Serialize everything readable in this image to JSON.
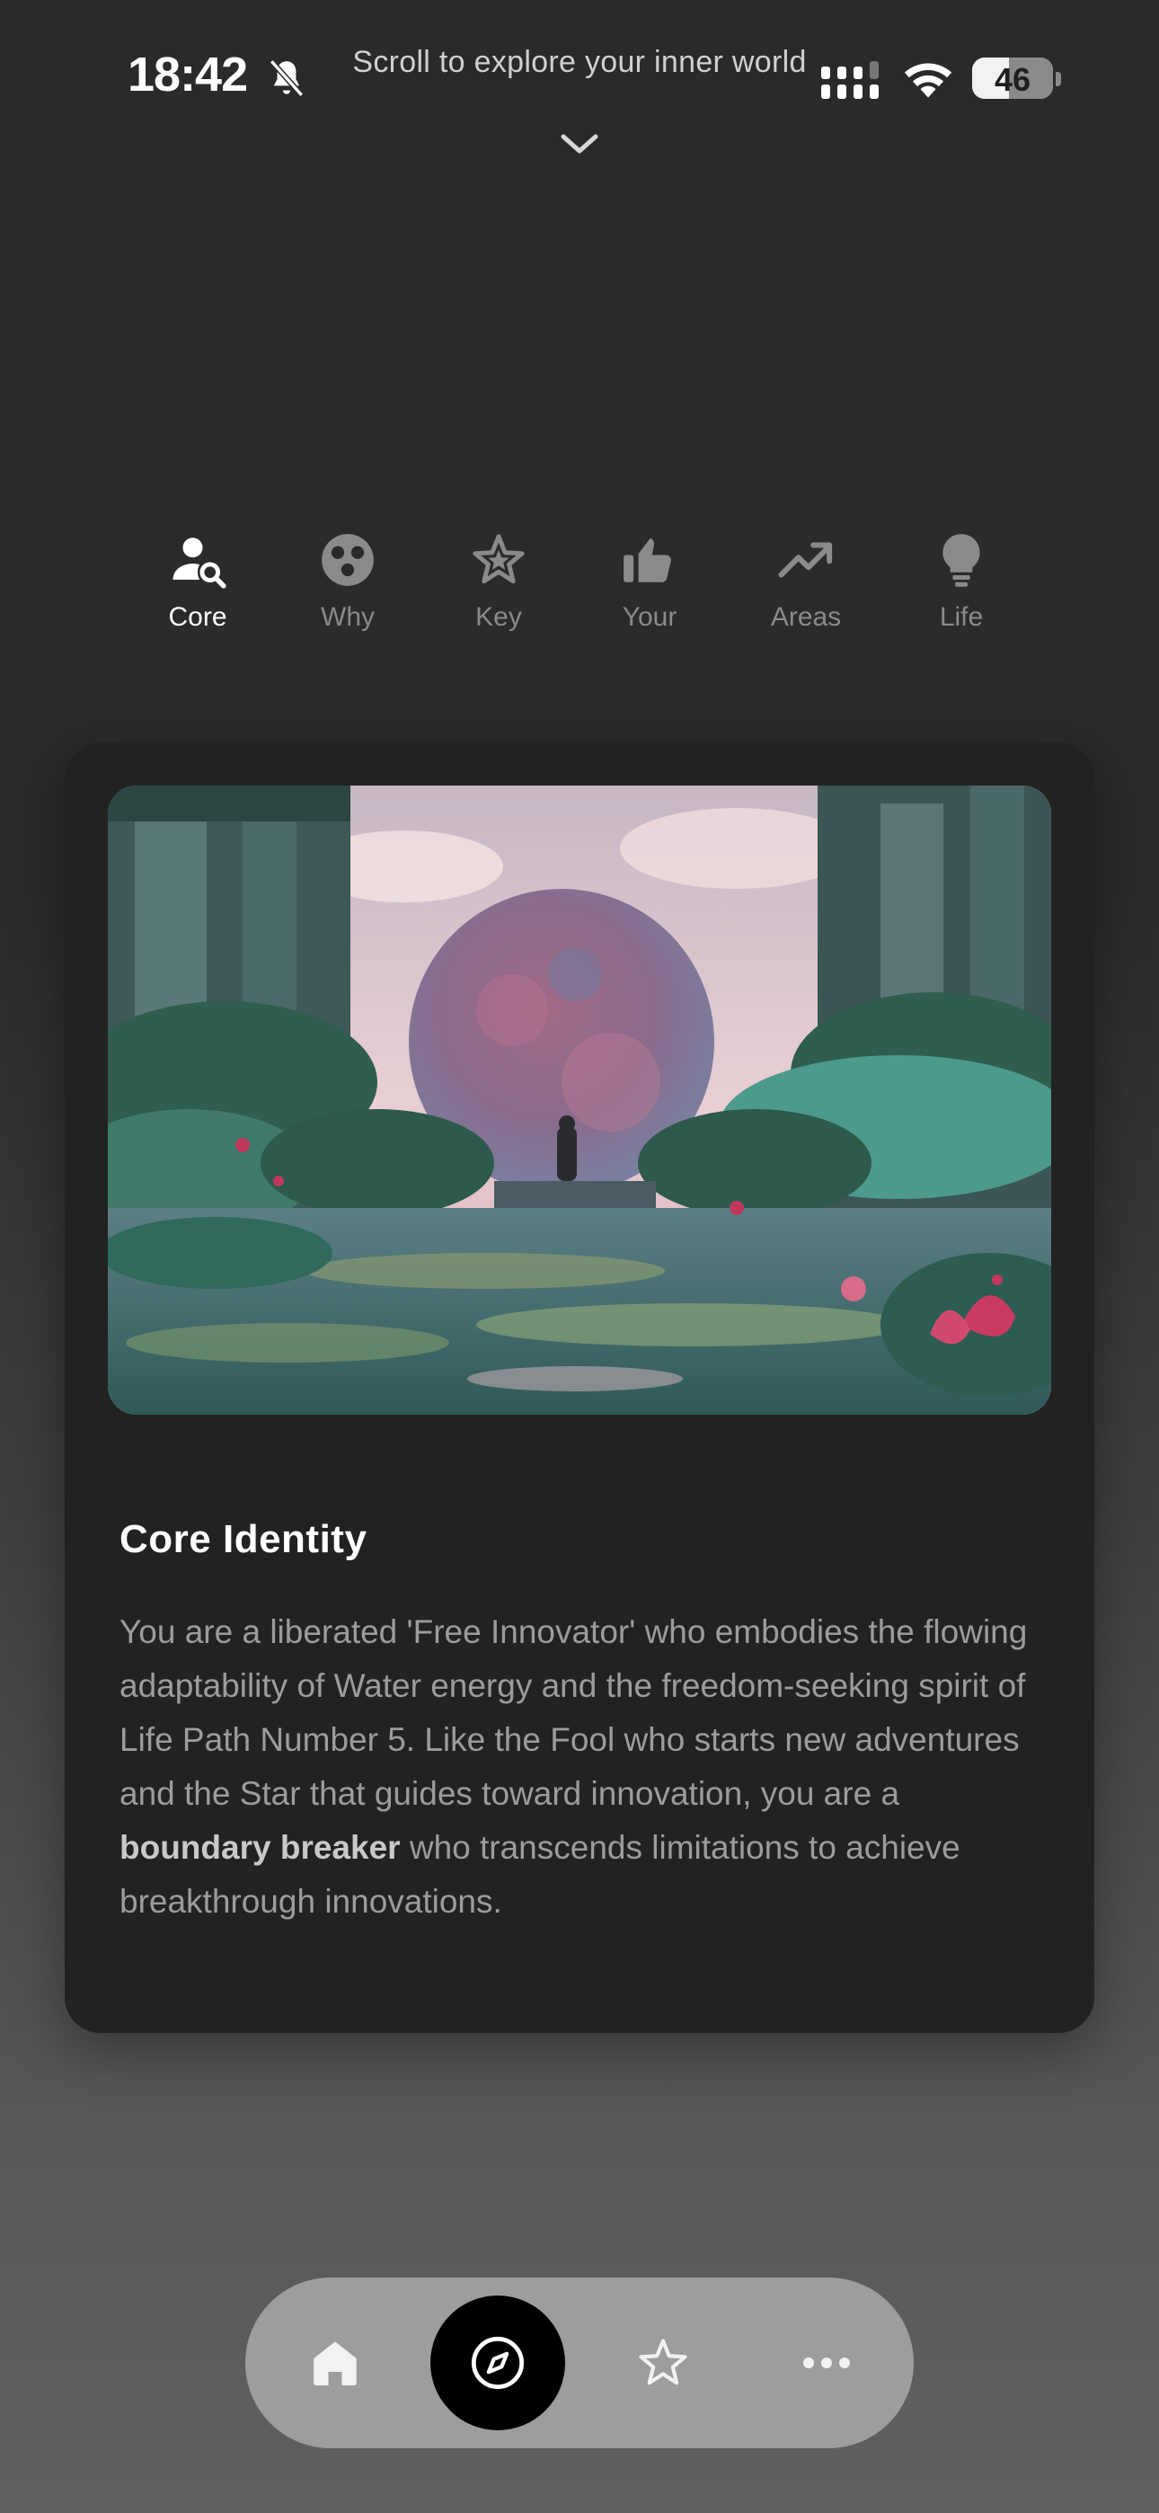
{
  "status_bar": {
    "time": "18:42",
    "battery": "46",
    "battery_level": 0.46,
    "icons": [
      "bell-muted-icon",
      "signal-icon",
      "wifi-icon",
      "battery-icon"
    ]
  },
  "header": {
    "scroll_hint": "Scroll to explore your inner world",
    "chevron": "chevron-down-icon"
  },
  "tabs": [
    {
      "label": "Core",
      "icon": "person-search-icon",
      "active": true
    },
    {
      "label": "Why",
      "icon": "circles-icon",
      "active": false
    },
    {
      "label": "Key",
      "icon": "star-icon",
      "active": false
    },
    {
      "label": "Your",
      "icon": "thumbs-up-icon",
      "active": false
    },
    {
      "label": "Areas",
      "icon": "trending-up-icon",
      "active": false
    },
    {
      "label": "Life",
      "icon": "lightbulb-icon",
      "active": false
    }
  ],
  "card": {
    "image": "painting of a pink moon over a lotus pond in ruined temple",
    "title": "Core Identity",
    "body_before": "You are a liberated 'Free Innovator' who embodies the flowing adaptability of Water energy and the freedom-seeking spirit of Life Path Number 5. Like the Fool who starts new adventures and the Star that guides toward innovation, you are a ",
    "body_bold": "boundary breaker",
    "body_after": " who transcends limitations to achieve breakthrough innovations."
  },
  "bottom_nav": {
    "items": [
      {
        "icon": "home-icon",
        "active": false
      },
      {
        "icon": "compass-icon",
        "active": true
      },
      {
        "icon": "star-icon",
        "active": false
      },
      {
        "icon": "more-icon",
        "active": false
      }
    ]
  },
  "colors": {
    "background_top": "#2a2a2b",
    "card": "#222222",
    "nav_pill": "#9c9d9e",
    "active_tab": "#ffffff",
    "inactive_tab": "#8a8a8a"
  }
}
